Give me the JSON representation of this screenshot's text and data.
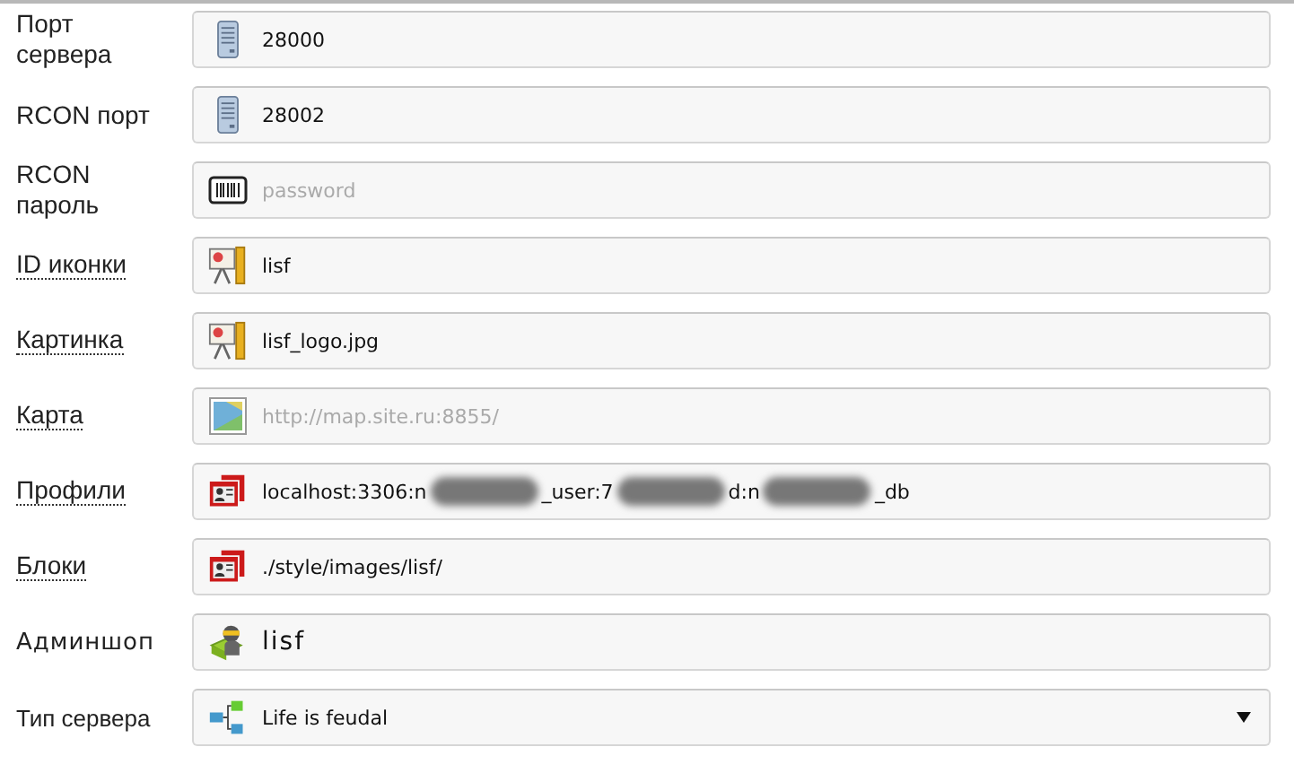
{
  "fields": [
    {
      "label": "Порт сервера",
      "hint": false,
      "kind": "text",
      "value": "28000"
    },
    {
      "label": "RCON порт",
      "hint": false,
      "kind": "text",
      "value": "28002"
    },
    {
      "label": "RCON пароль",
      "hint": false,
      "kind": "text",
      "placeholder": "password"
    },
    {
      "label": "ID иконки",
      "hint": true,
      "kind": "text",
      "value": "lisf"
    },
    {
      "label": "Картинка",
      "hint": true,
      "kind": "text",
      "value": "lisf_logo.jpg"
    },
    {
      "label": "Карта",
      "hint": true,
      "kind": "text",
      "placeholder": "http://map.site.ru:8855/"
    },
    {
      "label": "Профили",
      "hint": true,
      "kind": "text",
      "value_parts": [
        "localhost:3306:n",
        "_user:7",
        "d:n",
        "_db"
      ]
    },
    {
      "label": "Блоки",
      "hint": true,
      "kind": "text",
      "value": "./style/images/lisf/"
    },
    {
      "label": "Админшоп",
      "hint": false,
      "glow": true,
      "kind": "text",
      "value": "lisf"
    },
    {
      "label": "Тип сервера",
      "hint": false,
      "kind": "select",
      "value": "Life is feudal"
    }
  ]
}
